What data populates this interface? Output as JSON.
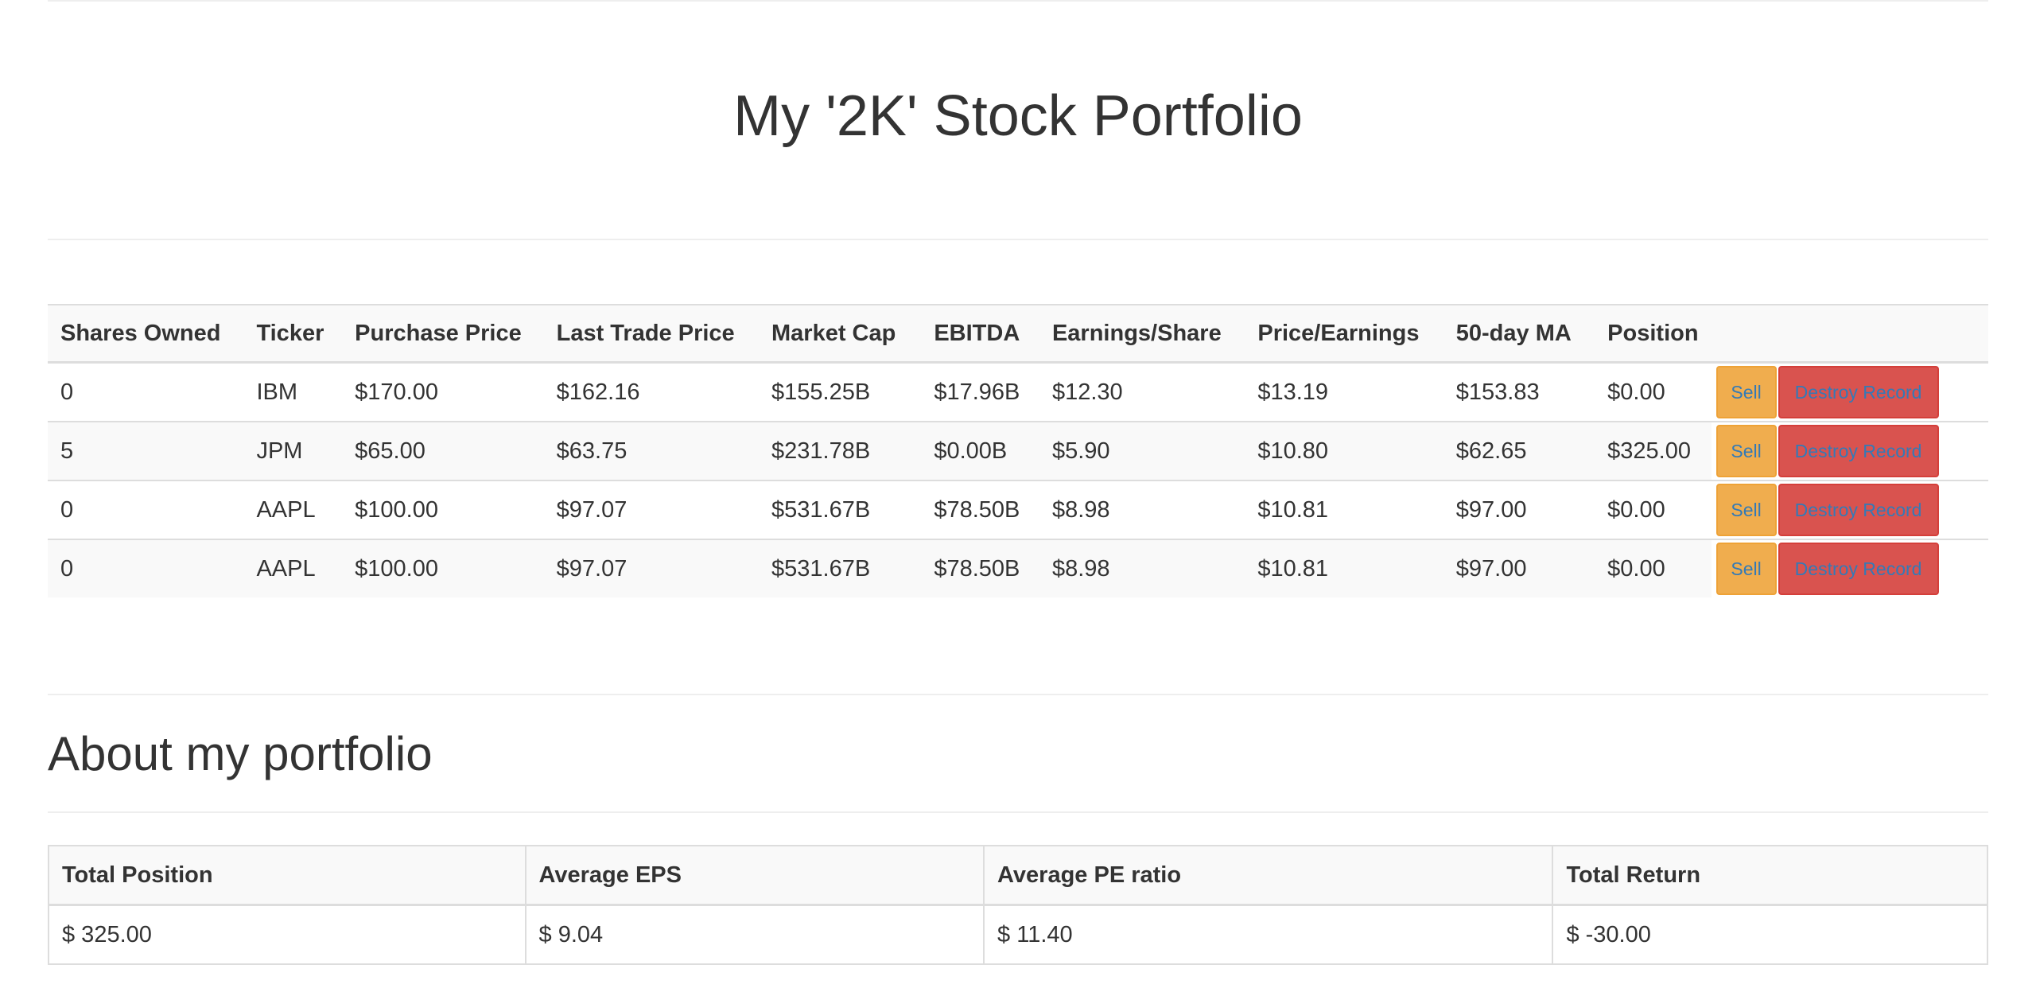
{
  "page_title": "My '2K' Stock Portfolio",
  "holdings": {
    "headers": [
      "Shares Owned",
      "Ticker",
      "Purchase Price",
      "Last Trade Price",
      "Market Cap",
      "EBITDA",
      "Earnings/Share",
      "Price/Earnings",
      "50-day MA",
      "Position"
    ],
    "rows": [
      {
        "shares": "0",
        "ticker": "IBM",
        "purchase_price": "$170.00",
        "last_trade_price": "$162.16",
        "market_cap": "$155.25B",
        "ebitda": "$17.96B",
        "eps": "$12.30",
        "pe": "$13.19",
        "ma50": "$153.83",
        "position": "$0.00"
      },
      {
        "shares": "5",
        "ticker": "JPM",
        "purchase_price": "$65.00",
        "last_trade_price": "$63.75",
        "market_cap": "$231.78B",
        "ebitda": "$0.00B",
        "eps": "$5.90",
        "pe": "$10.80",
        "ma50": "$62.65",
        "position": "$325.00"
      },
      {
        "shares": "0",
        "ticker": "AAPL",
        "purchase_price": "$100.00",
        "last_trade_price": "$97.07",
        "market_cap": "$531.67B",
        "ebitda": "$78.50B",
        "eps": "$8.98",
        "pe": "$10.81",
        "ma50": "$97.00",
        "position": "$0.00"
      },
      {
        "shares": "0",
        "ticker": "AAPL",
        "purchase_price": "$100.00",
        "last_trade_price": "$97.07",
        "market_cap": "$531.67B",
        "ebitda": "$78.50B",
        "eps": "$8.98",
        "pe": "$10.81",
        "ma50": "$97.00",
        "position": "$0.00"
      }
    ],
    "sell_label": "Sell",
    "destroy_label": "Destroy Record"
  },
  "about": {
    "heading": "About my portfolio",
    "headers": [
      "Total Position",
      "Average EPS",
      "Average PE ratio",
      "Total Return"
    ],
    "values": [
      "$ 325.00",
      "$ 9.04",
      "$ 11.40",
      "$ -30.00"
    ]
  },
  "colors": {
    "sell_button": "#f0ad4e",
    "destroy_button": "#d9534f",
    "link_text": "#337ab7",
    "stripe": "#f9f9f9",
    "border": "#dddddd"
  }
}
